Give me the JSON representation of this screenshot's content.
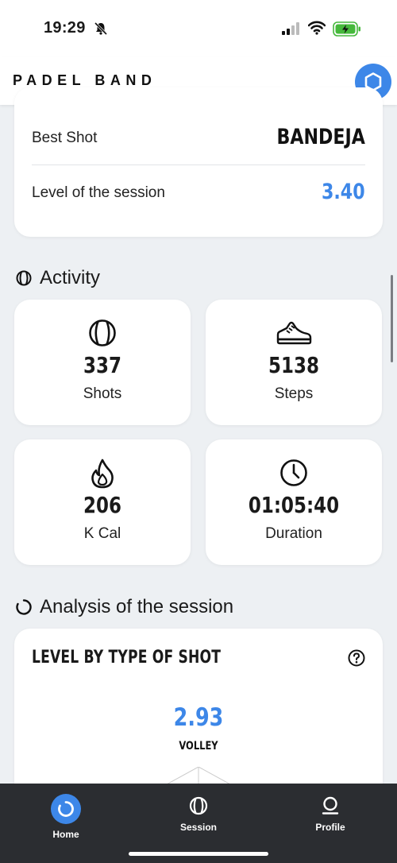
{
  "status_bar": {
    "time": "19:29"
  },
  "header": {
    "brand": "PADEL BAND"
  },
  "summary": {
    "best_shot_label": "Best Shot",
    "best_shot_value": "BANDEJA",
    "level_label": "Level of the session",
    "level_value": "3.40"
  },
  "activity": {
    "title": "Activity",
    "stats": [
      {
        "value": "337",
        "label": "Shots",
        "icon": "padel-ball-icon"
      },
      {
        "value": "5138",
        "label": "Steps",
        "icon": "sneaker-icon"
      },
      {
        "value": "206",
        "label": "K Cal",
        "icon": "flame-icon"
      },
      {
        "value": "01:05:40",
        "label": "Duration",
        "icon": "clock-icon"
      }
    ]
  },
  "analysis": {
    "title": "Analysis of the session",
    "card_title": "LEVEL BY TYPE OF SHOT",
    "shot_value": "2.93",
    "shot_type": "VOLLEY"
  },
  "nav": {
    "items": [
      {
        "label": "Home",
        "icon": "refresh-icon",
        "active": true
      },
      {
        "label": "Session",
        "icon": "padel-ball-icon",
        "active": false
      },
      {
        "label": "Profile",
        "icon": "user-icon",
        "active": false
      }
    ]
  },
  "colors": {
    "accent": "#3d87e8",
    "nav_bg": "#2b2d31",
    "page_bg": "#edf0f3"
  }
}
